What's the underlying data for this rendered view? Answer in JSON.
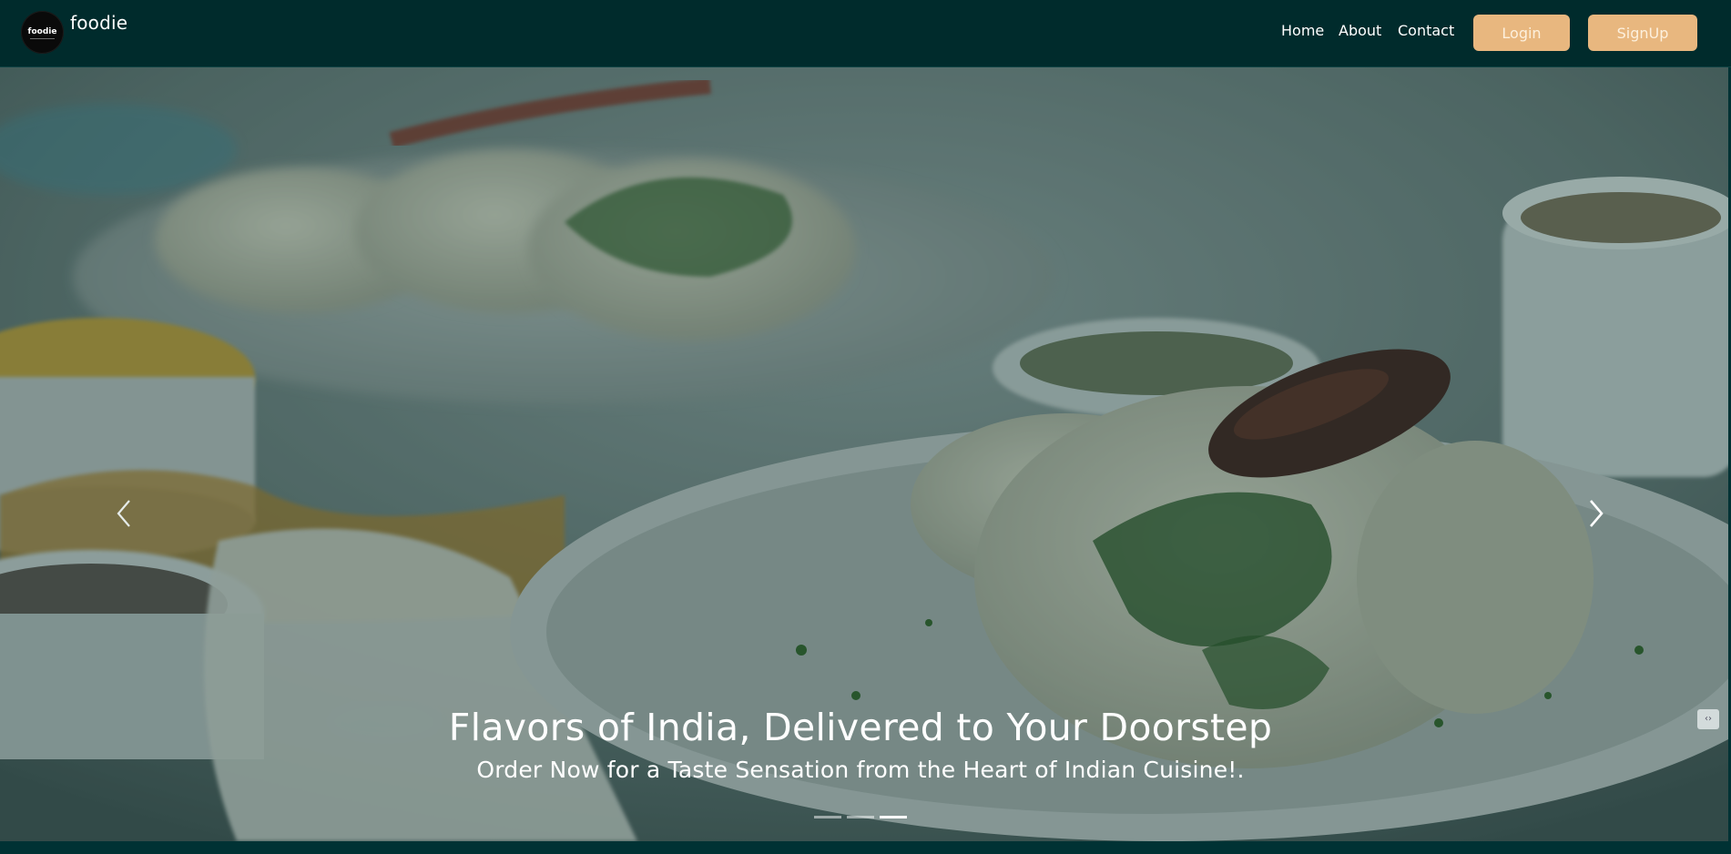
{
  "brand": {
    "logo_text": "foodie",
    "name": "foodie"
  },
  "nav": {
    "links": [
      {
        "label": "Home"
      },
      {
        "label": "About"
      },
      {
        "label": "Contact"
      }
    ],
    "login_label": "Login",
    "signup_label": "SignUp"
  },
  "hero": {
    "title": "Flavors of India, Delivered to Your Doorstep",
    "subtitle": "Order Now for a Taste Sensation from the Heart of Indian Cuisine!.",
    "slide_count": 3,
    "active_slide": 3,
    "prev_icon": "chevron-left-icon",
    "next_icon": "chevron-right-icon"
  },
  "colors": {
    "nav_background": "#002b2c",
    "button_accent": "#e8b77f",
    "button_text": "#fdf0dd"
  }
}
